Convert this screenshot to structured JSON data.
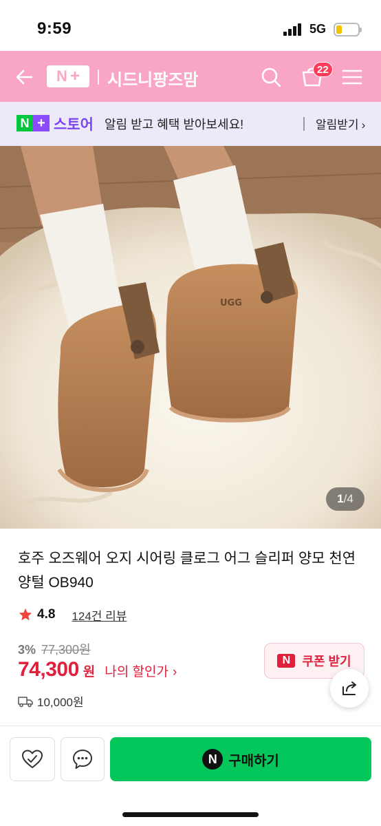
{
  "status": {
    "time": "9:59",
    "network": "5G",
    "battery_color": "#f5c400"
  },
  "app_bar": {
    "background": "#f9a6c6",
    "logo_n": "N",
    "logo_plus": "+",
    "store_name": "시드니팡즈맘",
    "cart_count": "22"
  },
  "notice": {
    "logo_n": "N",
    "logo_plus": "+",
    "store_label": "스토어",
    "message": "알림 받고 혜택 받아보세요!",
    "link": "알림받기",
    "link_chevron": "›"
  },
  "image": {
    "current": "1",
    "total": "4",
    "separator": "/",
    "logo_text": "UGG"
  },
  "product": {
    "title": "호주 오즈웨어 오지 시어링 클로그 어그 슬리퍼 양모 천연양털 OB940",
    "rating": "4.8",
    "reviews": "124건 리뷰",
    "discount": "3%",
    "original_price": "77,300원",
    "price": "74,300",
    "currency": "원",
    "my_discount": "나의 할인가",
    "my_discount_chevron": "›",
    "shipping_fee": "10,000원",
    "price_color": "#e0203c"
  },
  "coupon": {
    "icon": "N",
    "label": "쿠폰 받기"
  },
  "bottom": {
    "buy_icon": "N",
    "buy_label": "구매하기",
    "buy_color": "#03c75a"
  }
}
